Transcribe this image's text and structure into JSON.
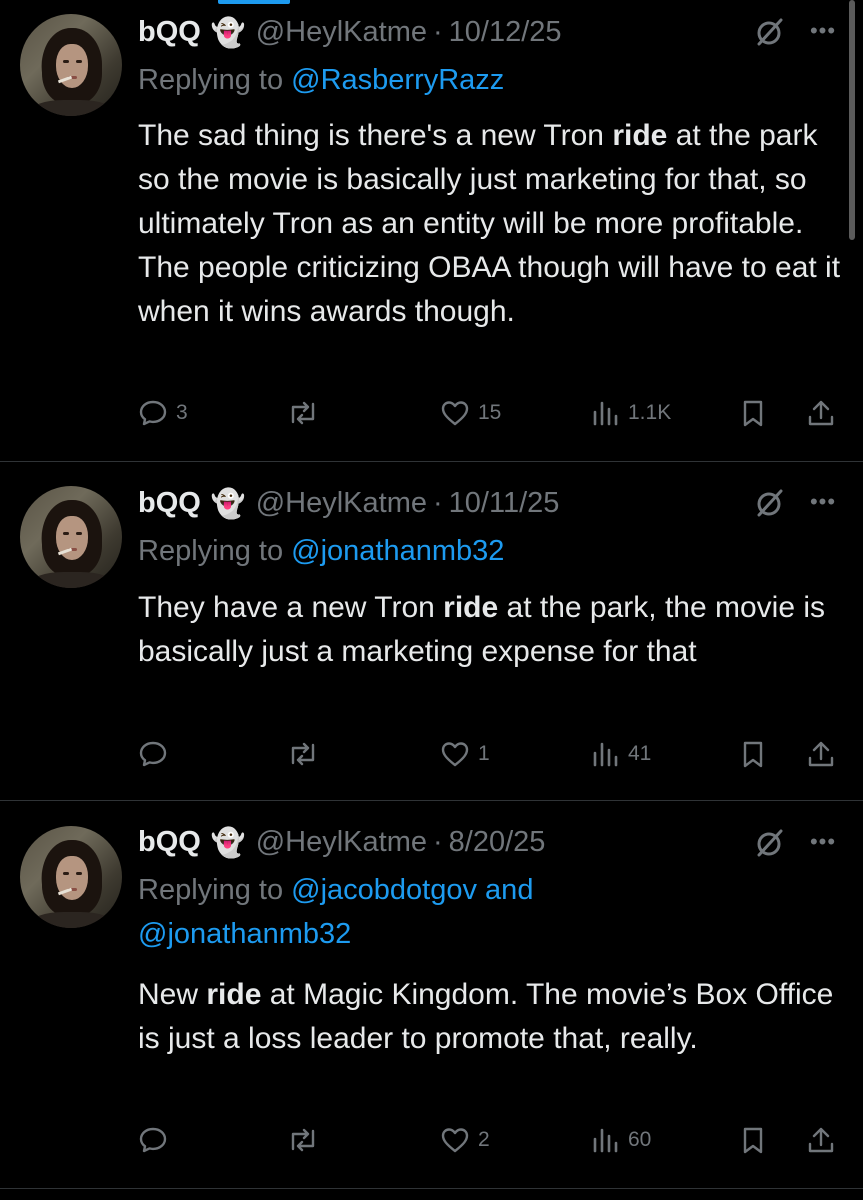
{
  "tweets": [
    {
      "name": "bQQ",
      "emoji": "👻",
      "handle": "@HeylKatme",
      "separator": "·",
      "date": "10/12/25",
      "replying_prefix": "Replying to ",
      "mention_1": "@RasberryRazz",
      "mention_join": "",
      "mention_2": "",
      "body_parts": [
        "The sad thing is there's a new Tron ",
        "ride",
        " at the park so the movie is basically just marketing for that, so ultimately Tron as an entity will be more profitable. The people criticizing OBAA though will have to eat it when it wins awards though."
      ],
      "replies": "3",
      "reposts": "",
      "likes": "15",
      "views": "1.1K"
    },
    {
      "name": "bQQ",
      "emoji": "👻",
      "handle": "@HeylKatme",
      "separator": "·",
      "date": "10/11/25",
      "replying_prefix": "Replying to ",
      "mention_1": "@jonathanmb32",
      "mention_join": "",
      "mention_2": "",
      "body_parts": [
        "They have a new Tron ",
        "ride",
        " at the park, the movie is basically just a marketing expense for that"
      ],
      "replies": "",
      "reposts": "",
      "likes": "1",
      "views": "41"
    },
    {
      "name": "bQQ",
      "emoji": "👻",
      "handle": "@HeylKatme",
      "separator": "·",
      "date": "8/20/25",
      "replying_prefix": "Replying to ",
      "mention_1": "@jacobdotgov",
      "mention_join": " and",
      "mention_2": "@jonathanmb32",
      "body_parts": [
        "New ",
        "ride",
        " at Magic Kingdom. The movie’s Box Office is just a loss leader to promote that, really."
      ],
      "replies": "",
      "reposts": "",
      "likes": "2",
      "views": "60"
    }
  ],
  "icons": {
    "reply": "reply-icon",
    "repost": "repost-icon",
    "like": "heart-icon",
    "views": "views-icon",
    "bookmark": "bookmark-icon",
    "share": "share-icon",
    "grok": "grok-icon",
    "more": "more-icon"
  },
  "colors": {
    "background": "#000000",
    "text": "#e7e9ea",
    "muted": "#71767b",
    "link": "#1d9bf0",
    "divider": "#2f3336"
  }
}
